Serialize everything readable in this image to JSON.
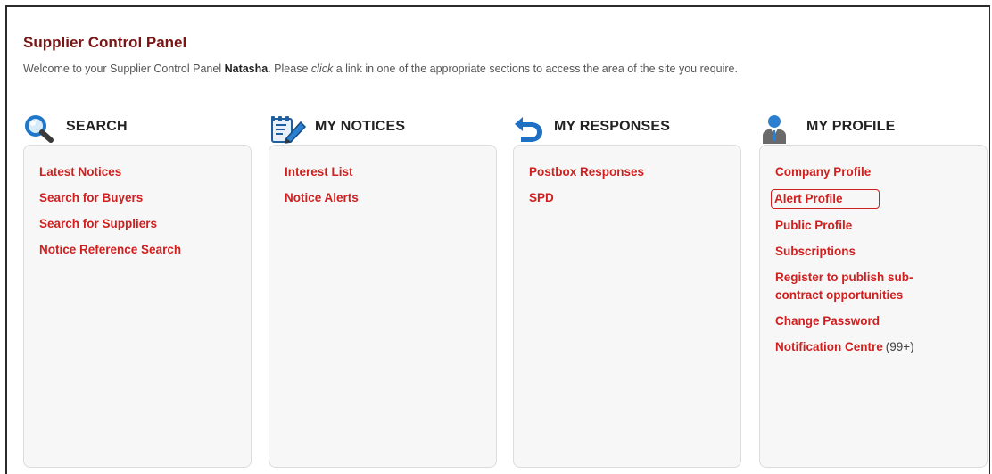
{
  "header": {
    "title": "Supplier Control Panel",
    "welcome_prefix": "Welcome to your Supplier Control Panel",
    "user_name": "Natasha",
    "welcome_mid": ". Please",
    "welcome_click": "click",
    "welcome_suffix": "a link in one of the appropriate sections to access the area of the site you require."
  },
  "sections": {
    "search": {
      "heading": "SEARCH",
      "icon": "magnifier-icon",
      "links": [
        "Latest Notices",
        "Search for Buyers",
        "Search for Suppliers",
        "Notice Reference Search"
      ]
    },
    "notices": {
      "heading": "MY NOTICES",
      "icon": "edit-notepad-icon",
      "links": [
        "Interest List",
        "Notice Alerts"
      ]
    },
    "responses": {
      "heading": "MY RESPONSES",
      "icon": "reply-arrow-icon",
      "links": [
        "Postbox Responses",
        "SPD"
      ]
    },
    "profile": {
      "heading": "MY PROFILE",
      "icon": "user-profile-icon",
      "links": [
        "Company Profile",
        "Alert Profile",
        "Public Profile",
        "Subscriptions",
        "Register to publish sub-contract opportunities",
        "Change Password",
        "Notification Centre"
      ],
      "notification_count": "(99+)",
      "highlighted_link": "Alert Profile"
    }
  },
  "colors": {
    "title": "#7a1515",
    "link": "#d01f1f",
    "panel_bg": "#f7f7f7"
  }
}
